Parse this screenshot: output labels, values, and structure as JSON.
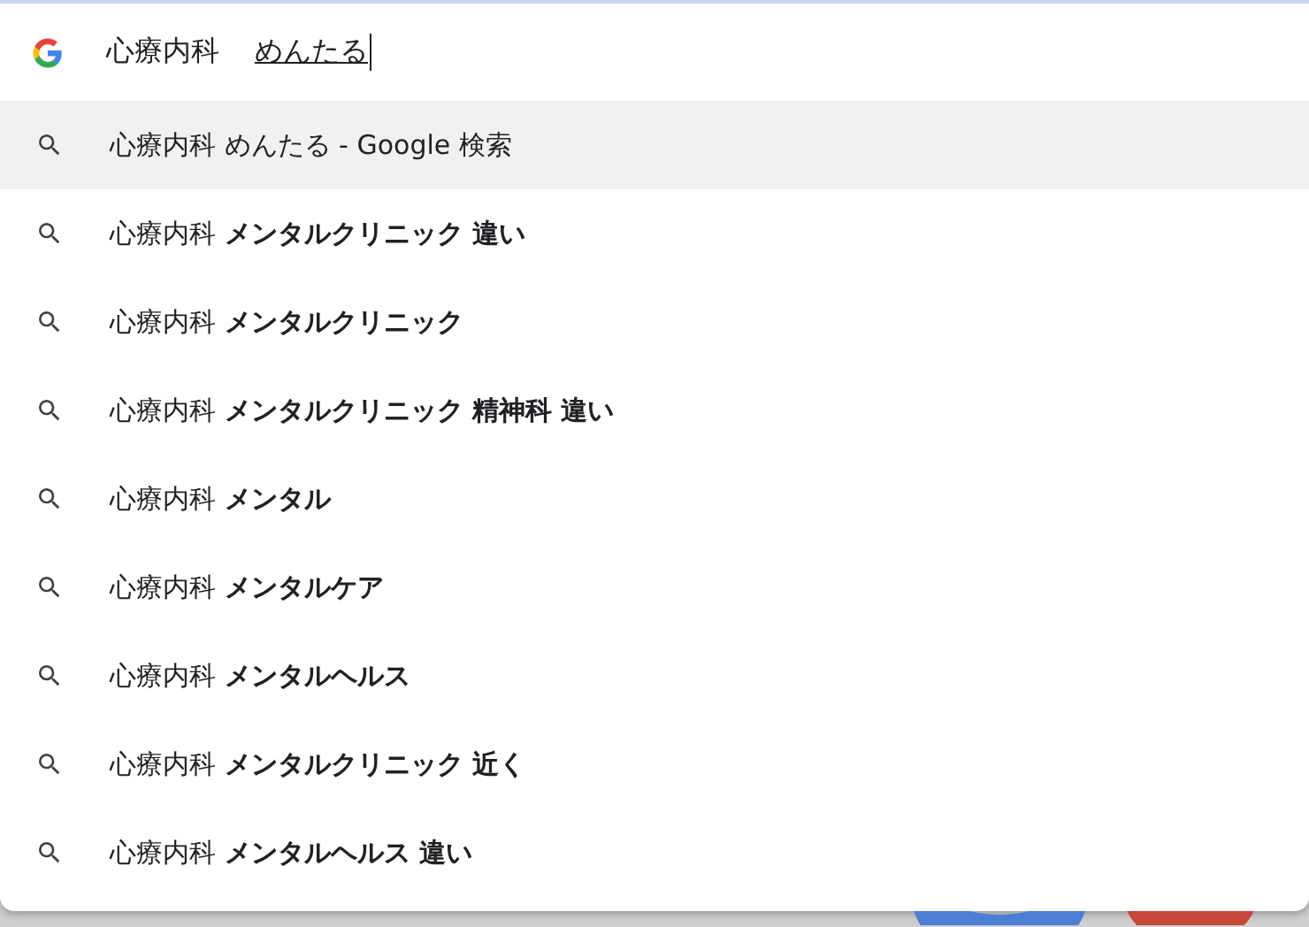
{
  "search": {
    "value": "心療内科",
    "composing": "めんたる"
  },
  "suggestions": [
    {
      "text": "心療内科 めんたる - Google 検索",
      "selected": true
    },
    {
      "text": "心療内科 **メンタルクリニック 違い**",
      "selected": false
    },
    {
      "text": "心療内科 **メンタルクリニック**",
      "selected": false
    },
    {
      "text": "心療内科 **メンタルクリニック 精神科 違い**",
      "selected": false
    },
    {
      "text": "心療内科 **メンタル**",
      "selected": false
    },
    {
      "text": "心療内科 **メンタルケア**",
      "selected": false
    },
    {
      "text": "心療内科 **メンタルヘルス**",
      "selected": false
    },
    {
      "text": "心療内科 **メンタルクリニック 近く**",
      "selected": false
    },
    {
      "text": "心療内科 **メンタルヘルス 違い**",
      "selected": false
    }
  ]
}
